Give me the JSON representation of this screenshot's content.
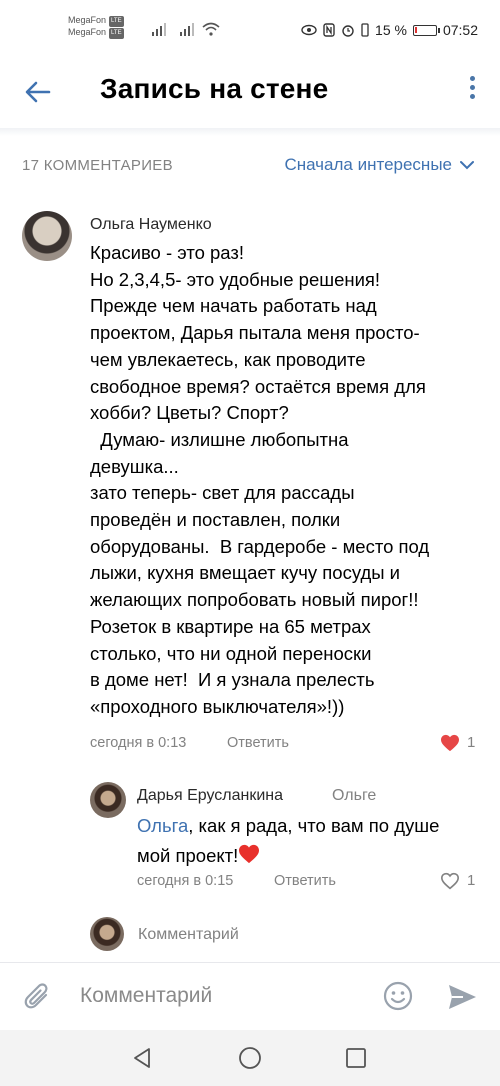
{
  "status_bar": {
    "carrier_1": "MegaFon",
    "carrier_2": "MegaFon",
    "network_badge": "LTE",
    "battery": "15 %",
    "time": "07:52"
  },
  "header": {
    "title": "Запись на стене"
  },
  "comments_header": {
    "count_label": "17 КОММЕНТАРИЕВ",
    "sort_label": "Сначала интересные"
  },
  "comments": [
    {
      "author": "Ольга Науменко",
      "text": "Красиво - это раз!\nНо 2,3,4,5- это удобные решения!\nПрежде чем начать работать над\nпроектом, Дарья пытала меня просто-\nчем увлекаетесь, как проводите\nсвободное время? остаётся время для\nхобби? Цветы? Спорт?\n  Думаю- излишне любопытна\nдевушка...\nзато теперь- свет для рассады\nпроведён и поставлен, полки\nоборудованы.  В гардеробе - место под\nлыжи, кухня вмещает кучу посуды и\nжелающих попробовать новый пирог!!\nРозеток в квартире на 65 метрах\nстолько, что ни одной переноски\nв доме нет!  И я узнала прелесть\n«проходного выключателя»!))",
      "time": "сегодня в 0:13",
      "reply_label": "Ответить",
      "likes": "1",
      "liked": true,
      "like_color": "#e64646"
    },
    {
      "author": "Дарья Еруслан­кина",
      "reply_to": "Ольге",
      "mention": "Ольга",
      "text_after_mention": ", как я рада, что вам по душе\nмой проект!",
      "emoji": "red-heart",
      "time": "сегодня в 0:15",
      "reply_label": "Ответить",
      "likes": "1",
      "liked": false
    }
  ],
  "inline_reply": {
    "placeholder": "Комментарий"
  },
  "composer": {
    "placeholder": "Комментарий"
  },
  "colors": {
    "accent": "#3f72b1",
    "secondary_text": "#828282",
    "like": "#e64646"
  },
  "icons": [
    "back-arrow-icon",
    "more-vertical-icon",
    "chevron-down-icon",
    "heart-icon",
    "paperclip-icon",
    "smile-icon",
    "send-icon",
    "nav-back-icon",
    "nav-home-icon",
    "nav-recent-icon"
  ]
}
